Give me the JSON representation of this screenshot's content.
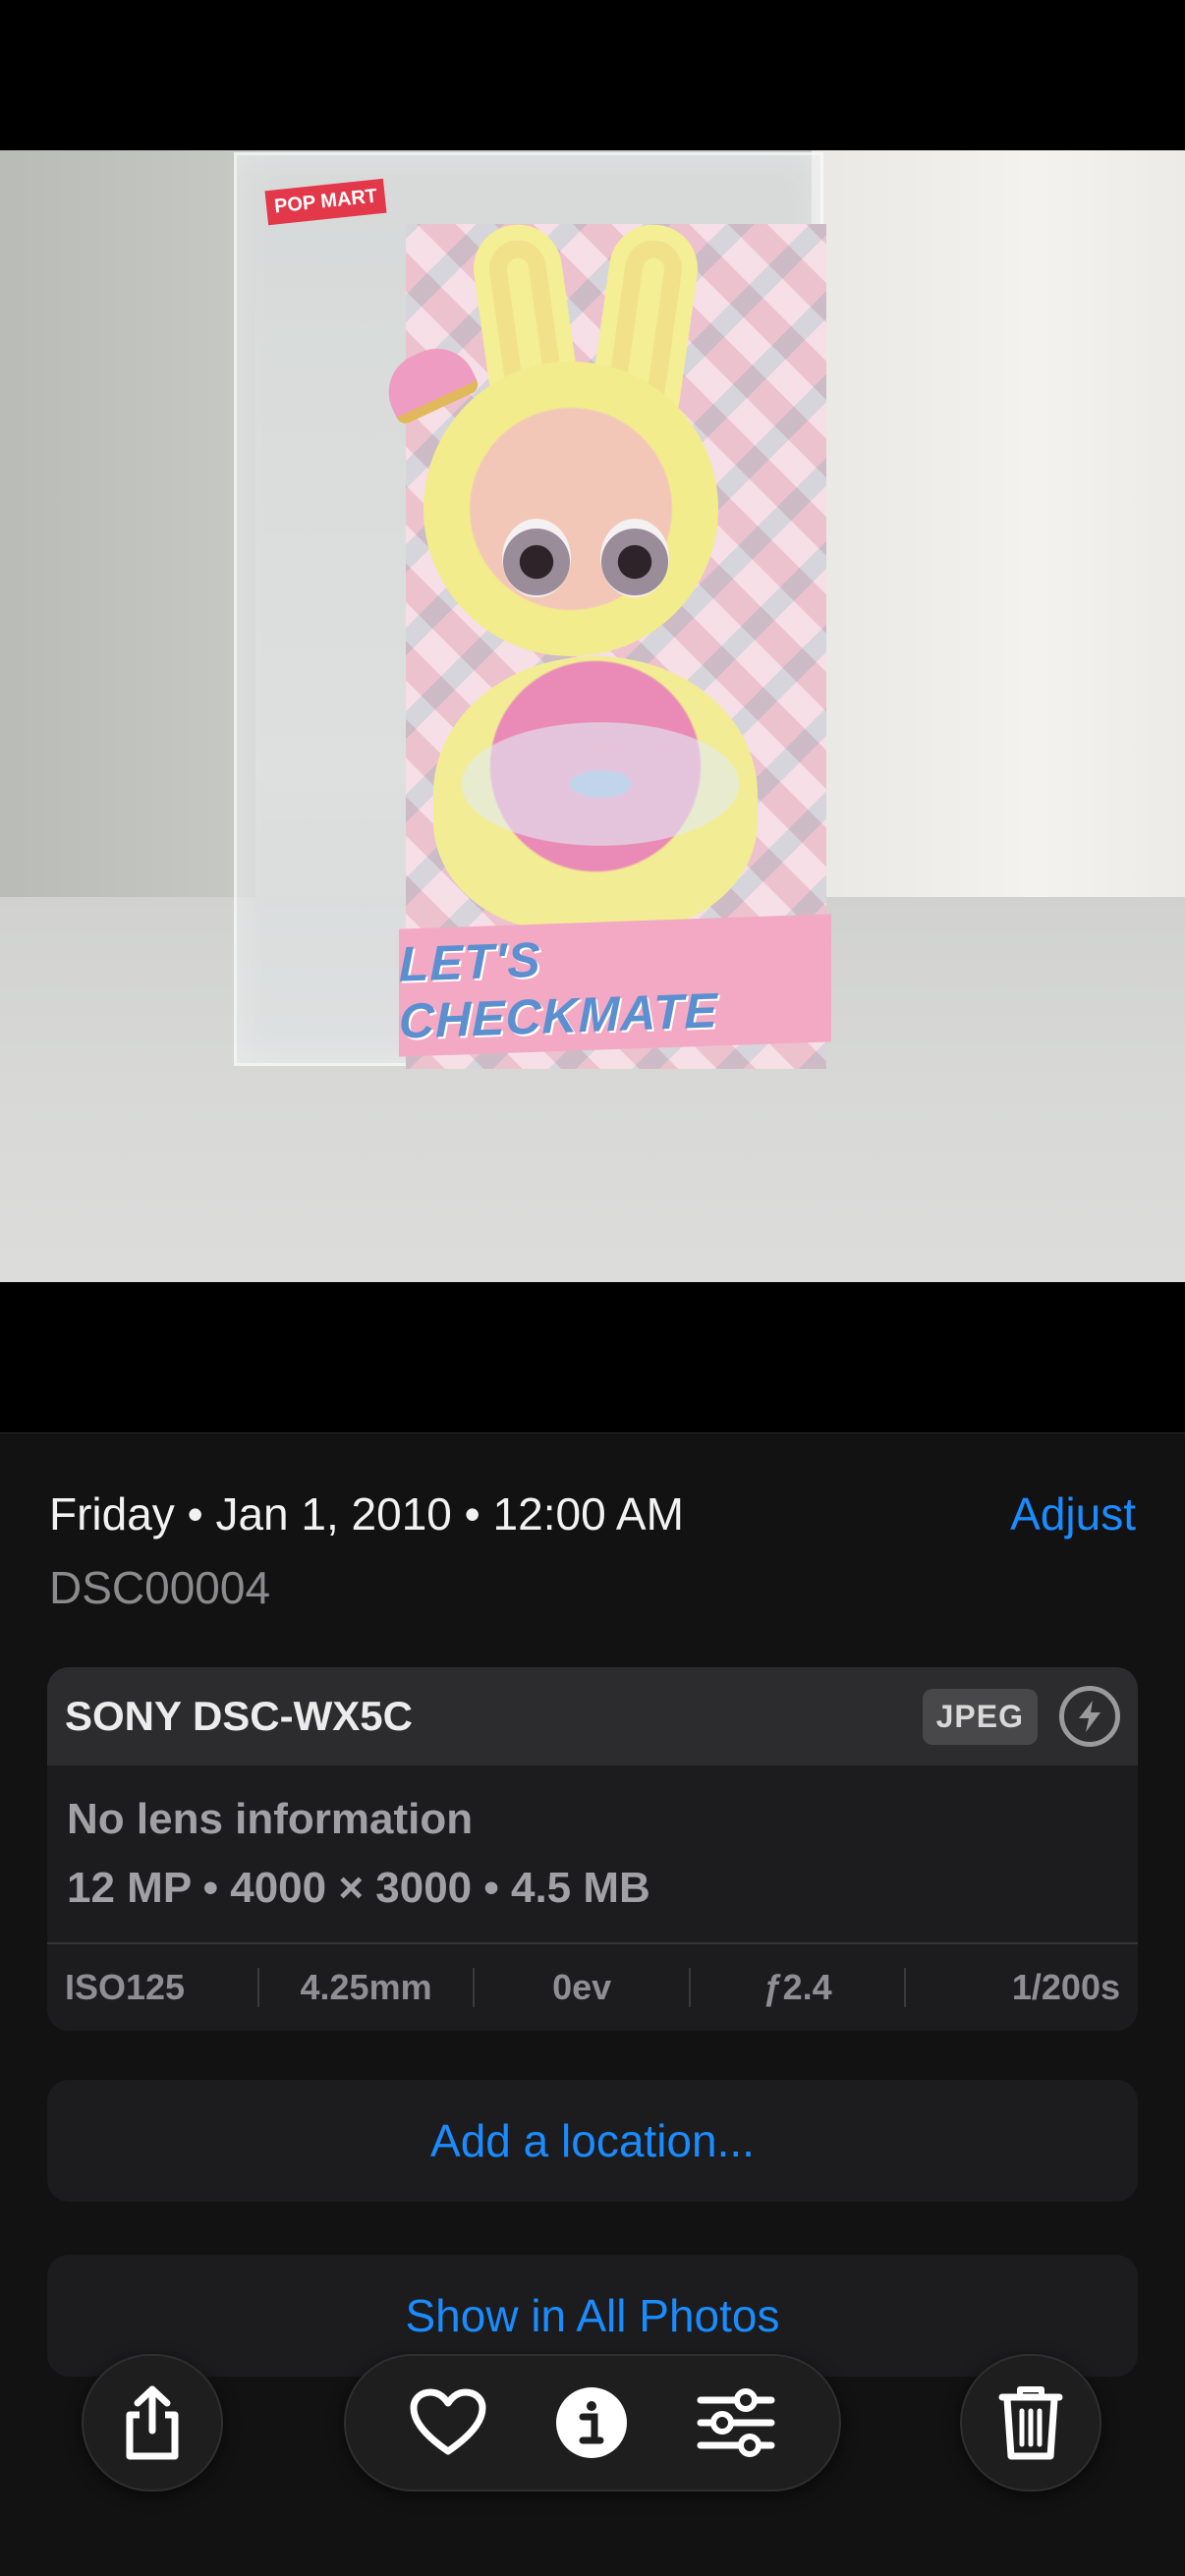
{
  "photo": {
    "brand_label": "POP MART",
    "box_title": "LET'S CHECKMATE"
  },
  "info": {
    "date": "Friday • Jan 1, 2010 • 12:00 AM",
    "adjust_label": "Adjust",
    "filename": "DSC00004"
  },
  "exif": {
    "camera": "SONY DSC-WX5C",
    "format": "JPEG",
    "lens": "No lens information",
    "details": "12 MP • 4000 × 3000 • 4.5 MB",
    "iso": "ISO125",
    "focal_length": "4.25mm",
    "exposure": "0ev",
    "aperture": "ƒ2.4",
    "shutter": "1/200s"
  },
  "actions": {
    "add_location": "Add a location...",
    "show_all": "Show in All Photos"
  },
  "toolbar": {
    "icons": [
      "share-icon",
      "heart-icon",
      "info-icon",
      "sliders-icon",
      "trash-icon"
    ]
  },
  "colors": {
    "accent": "#1a8cff",
    "panel_bg": "#121212",
    "card_bg": "#1c1c1e"
  }
}
